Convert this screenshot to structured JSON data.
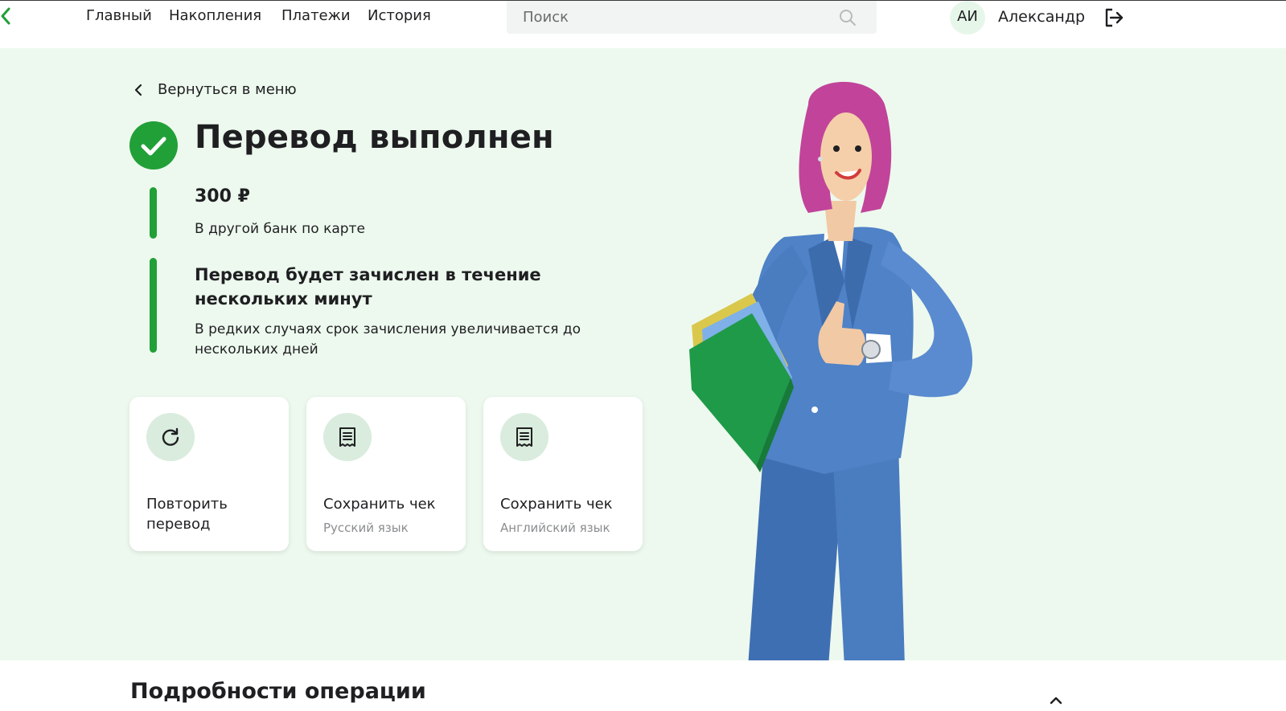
{
  "header": {
    "nav": [
      "Главный",
      "Накопления",
      "Платежи",
      "История"
    ],
    "search_placeholder": "Поиск",
    "user_initials": "АИ",
    "user_name": "Александр"
  },
  "operation": {
    "back_label": "Вернуться в меню",
    "title": "Перевод выполнен",
    "amount": "300 ₽",
    "amount_description": "В другой банк по карте",
    "note_title": "Перевод будет зачислен в течение нескольких минут",
    "note_text": "В редких случаях срок зачисления увеличивается до нескольких дней"
  },
  "actions": [
    {
      "label": "Повторить перевод",
      "icon": "repeat-icon"
    },
    {
      "label": "Сохранить чек",
      "sublabel": "Русский язык",
      "icon": "receipt-icon"
    },
    {
      "label": "Сохранить чек",
      "sublabel": "Английский язык",
      "icon": "receipt-icon"
    }
  ],
  "details": {
    "title": "Подробности операции"
  },
  "colors": {
    "accent": "#21a038",
    "hero_background": "#edf9ee",
    "icon_circle": "#d9ecdd"
  }
}
